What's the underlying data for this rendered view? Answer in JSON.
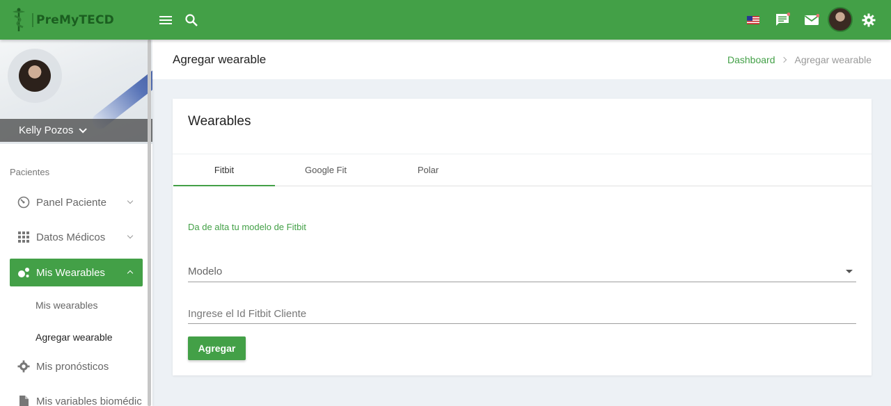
{
  "brand": {
    "name": "PreMyTECD",
    "color": "#43a047"
  },
  "topbar": {
    "icons": [
      "menu-icon",
      "search-icon",
      "us-flag-icon",
      "chat-icon",
      "mail-icon",
      "avatar",
      "settings-icon"
    ]
  },
  "profile": {
    "name": "Kelly Pozos"
  },
  "sidebar": {
    "section_label": "Pacientes",
    "items": [
      {
        "label": "Panel Paciente",
        "icon": "gauge-icon"
      },
      {
        "label": "Datos Médicos",
        "icon": "grid-icon"
      },
      {
        "label": "Mis Wearables",
        "icon": "bubbles-icon",
        "active": true
      },
      {
        "label": "Mis pronósticos",
        "icon": "cog-icon"
      },
      {
        "label": "Mis variables biomédic",
        "icon": "file-icon"
      }
    ],
    "subitems": [
      {
        "label": "Mis wearables"
      },
      {
        "label": "Agregar wearable",
        "current": true
      }
    ]
  },
  "header": {
    "title": "Agregar wearable",
    "breadcrumb": {
      "home": "Dashboard",
      "current": "Agregar wearable"
    }
  },
  "card": {
    "title": "Wearables",
    "tabs": [
      {
        "label": "Fitbit",
        "active": true
      },
      {
        "label": "Google Fit"
      },
      {
        "label": "Polar"
      }
    ],
    "hint": "Da de alta tu modelo de Fitbit",
    "model_select": {
      "value": "Modelo"
    },
    "client_id_input": {
      "placeholder": "Ingrese el Id Fitbit Cliente",
      "value": ""
    },
    "submit_label": "Agregar"
  }
}
